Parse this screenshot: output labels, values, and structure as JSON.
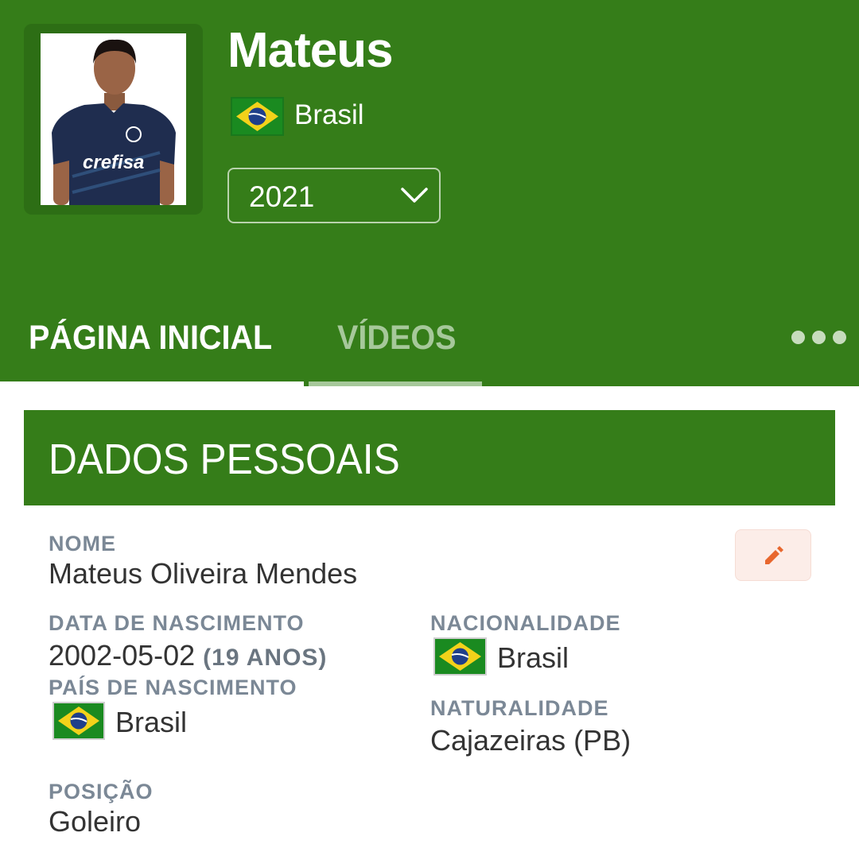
{
  "player": {
    "name": "Mateus",
    "country": "Brasil",
    "season": "2021",
    "jersey_sponsor": "crefisa"
  },
  "tabs": [
    {
      "label": "PÁGINA INICIAL",
      "active": true
    },
    {
      "label": "VÍDEOS",
      "active": false
    }
  ],
  "section": {
    "title": "DADOS PESSOAIS"
  },
  "fields": {
    "nome": {
      "label": "NOME",
      "value": "Mateus Oliveira Mendes"
    },
    "nascimento": {
      "label": "DATA DE NASCIMENTO",
      "value": "2002-05-02",
      "age": "(19 ANOS)"
    },
    "pais_nascimento": {
      "label": "PAÍS DE NASCIMENTO",
      "value": "Brasil"
    },
    "nacionalidade": {
      "label": "NACIONALIDADE",
      "value": "Brasil"
    },
    "naturalidade": {
      "label": "NATURALIDADE",
      "value": "Cajazeiras (PB)"
    },
    "posicao": {
      "label": "POSIÇÃO",
      "value": "Goleiro"
    }
  },
  "icons": {
    "more": "more-dots-icon",
    "edit": "pencil-icon",
    "select": "chevron-down-icon",
    "flag": "brazil-flag-icon"
  },
  "colors": {
    "brand_green": "#357d19",
    "label_gray": "#7b8896",
    "edit_accent": "#e8672e"
  }
}
